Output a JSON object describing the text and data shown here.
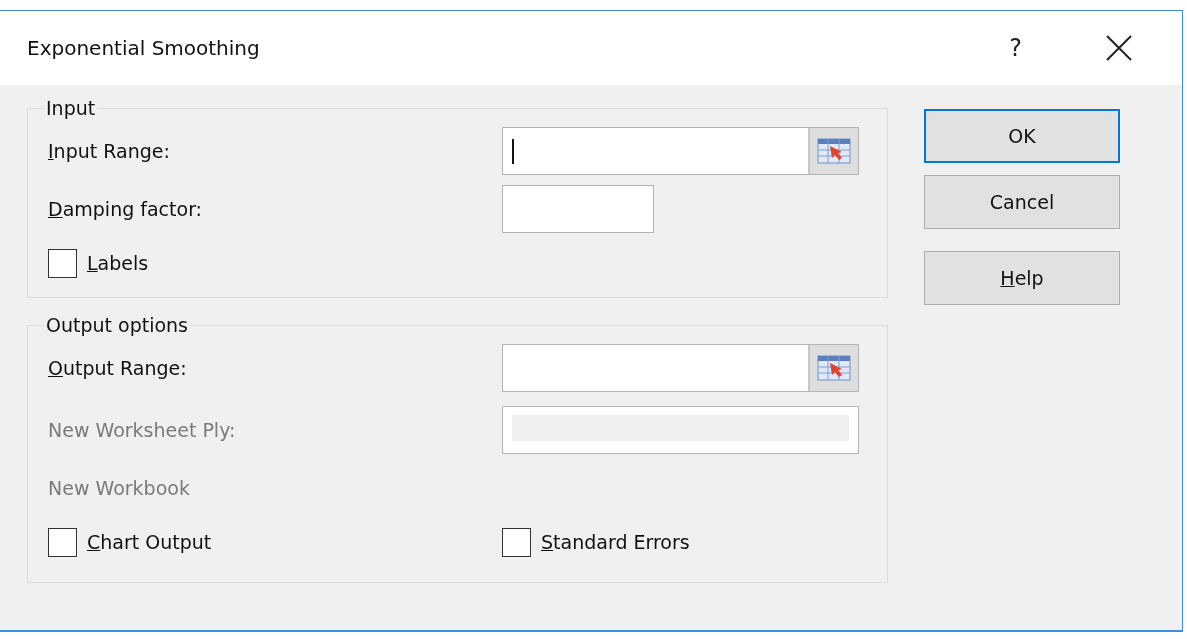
{
  "window": {
    "title": "Exponential Smoothing",
    "help_button": "?"
  },
  "groups": [
    {
      "title": "Input",
      "rows": [
        {
          "kind": "range",
          "label": "Input Range:",
          "mnemonic": true,
          "disabled": false,
          "focused": true
        },
        {
          "kind": "text",
          "label": "Damping factor:",
          "mnemonic": true,
          "disabled": false,
          "focused": false
        },
        {
          "kind": "checkboxes",
          "items": [
            {
              "label": "Labels",
              "mnemonic": true,
              "checked": false
            }
          ]
        }
      ]
    },
    {
      "title": "Output options",
      "rows": [
        {
          "kind": "range",
          "label": "Output Range:",
          "mnemonic": true,
          "disabled": false,
          "focused": false
        },
        {
          "kind": "wide",
          "label": "New Worksheet Ply:",
          "mnemonic": false,
          "disabled": true,
          "focused": false
        },
        {
          "kind": "plain",
          "label": "New Workbook",
          "mnemonic": false,
          "disabled": true
        },
        {
          "kind": "checkboxes",
          "items": [
            {
              "label": "Chart Output",
              "mnemonic": true,
              "checked": false
            },
            {
              "label": "Standard Errors",
              "mnemonic": true,
              "checked": false
            }
          ]
        }
      ]
    }
  ],
  "buttons": [
    {
      "label": "OK",
      "default": true,
      "mnemonic": false
    },
    {
      "label": "Cancel",
      "default": false,
      "mnemonic": false
    },
    {
      "label": "Help",
      "default": false,
      "mnemonic": true
    }
  ]
}
